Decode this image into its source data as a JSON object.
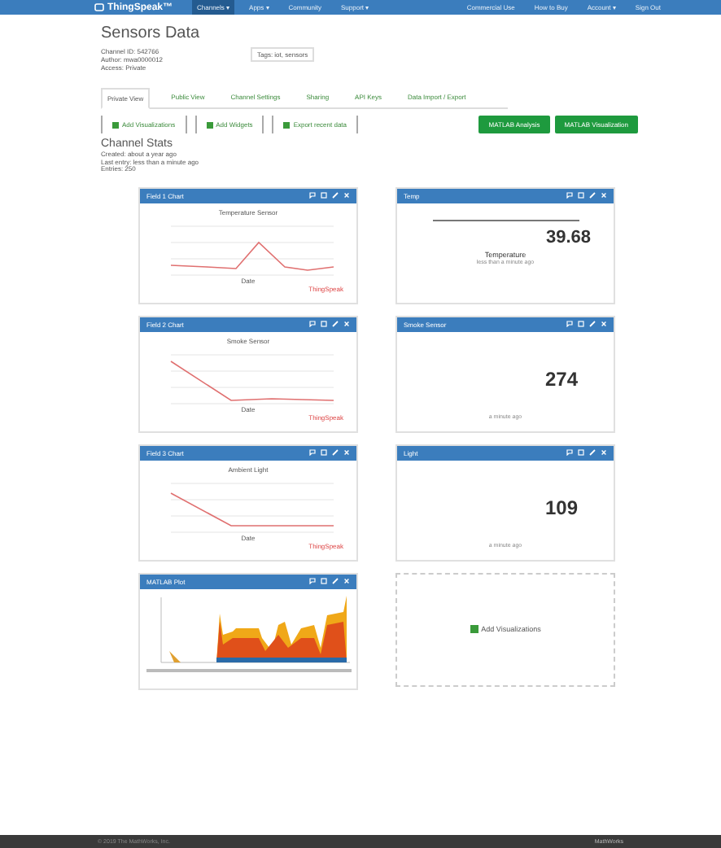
{
  "navbar": {
    "logo": "ThingSpeak™",
    "menu": [
      {
        "label": "Channels ▾",
        "selected": true
      },
      {
        "label": "Apps ▾",
        "selected": false
      },
      {
        "label": "Community",
        "selected": false
      },
      {
        "label": "Support ▾",
        "selected": false
      }
    ],
    "right": [
      "Commercial Use",
      "How to Buy",
      "Account ▾",
      "Sign Out"
    ]
  },
  "channel": {
    "title": "Sensors Data",
    "info": [
      "Channel ID: 542766",
      "Author: mwa0000012",
      "Access: Private"
    ],
    "tags": "Tags: iot, sensors"
  },
  "tabs": [
    {
      "label": "Private View",
      "selected": true
    },
    {
      "label": "Public View",
      "selected": false
    },
    {
      "label": "Channel Settings",
      "selected": false
    },
    {
      "label": "Sharing",
      "selected": false
    },
    {
      "label": "API Keys",
      "selected": false
    },
    {
      "label": "Data Import / Export",
      "selected": false
    }
  ],
  "tools": [
    "Add Visualizations",
    "Add Widgets",
    "Export recent data"
  ],
  "actions": [
    "MATLAB Analysis",
    "MATLAB Visualization"
  ],
  "stats": {
    "title": "Channel Stats",
    "lines": [
      "Created: about a year ago",
      "Last entry: less than a minute ago",
      "Entries: 250"
    ]
  },
  "cards": [
    {
      "kind": "chart",
      "title": "Field 1 Chart",
      "chart_title": "Temperature Sensor",
      "xlabel": "Date",
      "legend": "ThingSpeak"
    },
    {
      "kind": "gauge",
      "title": "Temp",
      "value": "39.68",
      "label": "Temperature",
      "note": "less than a minute ago"
    },
    {
      "kind": "chart",
      "title": "Field 2 Chart",
      "chart_title": "Smoke Sensor",
      "xlabel": "Date",
      "legend": "ThingSpeak"
    },
    {
      "kind": "numeric",
      "title": "Smoke Sensor",
      "value": "274",
      "note": "a minute ago"
    },
    {
      "kind": "chart",
      "title": "Field 3 Chart",
      "chart_title": "Ambient Light",
      "xlabel": "Date",
      "legend": "ThingSpeak"
    },
    {
      "kind": "numeric",
      "title": "Light",
      "value": "109",
      "note": "a minute ago"
    },
    {
      "kind": "plot",
      "title": "MATLAB Plot"
    },
    {
      "kind": "add",
      "label": "Add Visualizations"
    }
  ],
  "footer": {
    "text": "© 2019 The MathWorks, Inc.",
    "right": "MathWorks"
  }
}
